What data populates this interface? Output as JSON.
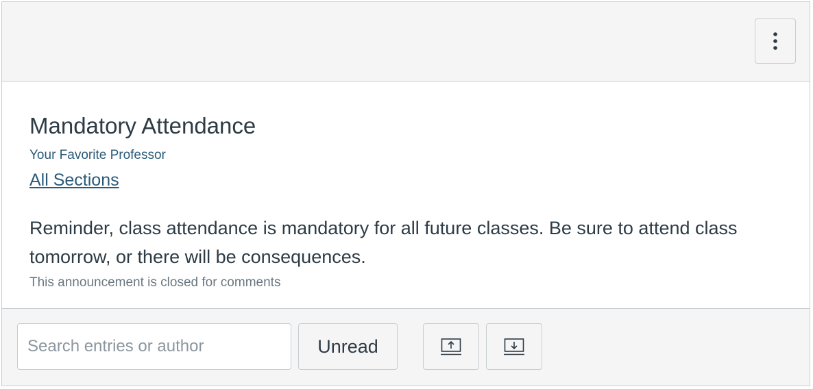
{
  "header": {
    "menu_icon": "kebab-menu-icon"
  },
  "announcement": {
    "title": "Mandatory Attendance",
    "author": "Your Favorite Professor",
    "sections_link": "All Sections",
    "message": "Reminder, class attendance is mandatory for all future classes. Be sure to attend class tomorrow, or there will be consequences.",
    "comments_status": "This announcement is closed for comments"
  },
  "toolbar": {
    "search_placeholder": "Search entries or author",
    "search_value": "",
    "unread_label": "Unread",
    "expand_icon": "expand-up-icon",
    "collapse_icon": "collapse-down-icon"
  }
}
